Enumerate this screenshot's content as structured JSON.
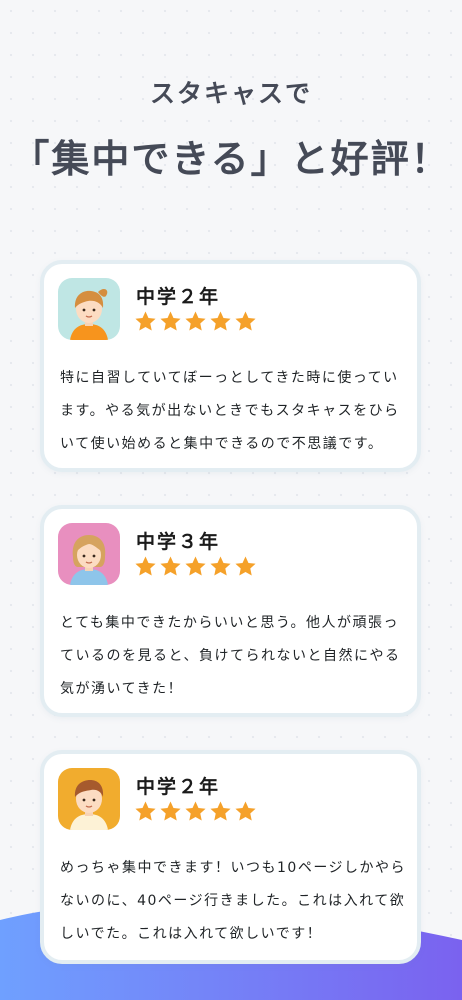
{
  "hero": {
    "subtitle": "スタキャスで",
    "title": "「集中できる」と好評！"
  },
  "colors": {
    "star": "#f5a12a",
    "heading": "#454a57",
    "wave_left": "#6f9bff",
    "wave_right": "#7a64f0"
  },
  "reviews": [
    {
      "grade": "中学２年",
      "rating": 5,
      "avatar_icon": "boy-with-ponytail-avatar-icon",
      "text": "特に自習していてぼーっとしてきた時に使っています。やる気が出ないときでもスタキャスをひらいて使い始めると集中できるので不思議です。"
    },
    {
      "grade": "中学３年",
      "rating": 5,
      "avatar_icon": "girl-avatar-icon",
      "text": "とても集中できたからいいと思う。他人が頑張っているのを見ると、負けてられないと自然にやる気が湧いてきた！"
    },
    {
      "grade": "中学２年",
      "rating": 5,
      "avatar_icon": "boy-avatar-icon",
      "text": "めっちゃ集中できます！いつも10ページしかやらないのに、40ページ行きました。これは入れて欲しいでた。これは入れて欲しいです！"
    }
  ]
}
